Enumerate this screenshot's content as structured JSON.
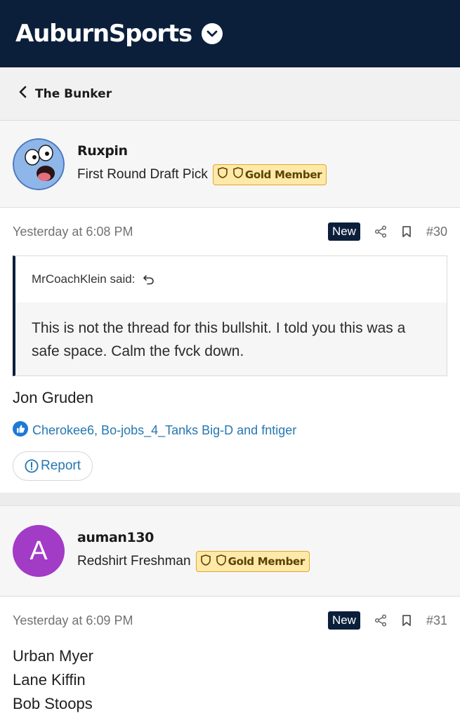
{
  "header": {
    "brand": "AuburnSports"
  },
  "breadcrumb": {
    "label": "The Bunker"
  },
  "posts": [
    {
      "username": "Ruxpin",
      "rank": "First Round Draft Pick",
      "badge": "Gold Member",
      "avatar_icon": "cartoon-face-icon",
      "date": "Yesterday at 6:08 PM",
      "new_label": "New",
      "number": "#30",
      "quote": {
        "author": "MrCoachKlein said:",
        "text": "This is not the thread for this bullshit. I told you this was a safe space. Calm the fvck down."
      },
      "text": "Jon Gruden",
      "reactions": "Cherokee6, Bo-jobs_4_Tanks Big-D and fntiger",
      "report_label": "Report"
    },
    {
      "username": "auman130",
      "rank": "Redshirt Freshman",
      "badge": "Gold Member",
      "avatar_letter": "A",
      "avatar_color": "#a23bc6",
      "date": "Yesterday at 6:09 PM",
      "new_label": "New",
      "number": "#31",
      "lines": [
        "Urban Myer",
        "Lane Kiffin",
        "Bob Stoops"
      ]
    }
  ],
  "colors": {
    "header_bg": "#0b1f3b",
    "link": "#2577b1",
    "badge_bg": "#ffe9a8"
  }
}
